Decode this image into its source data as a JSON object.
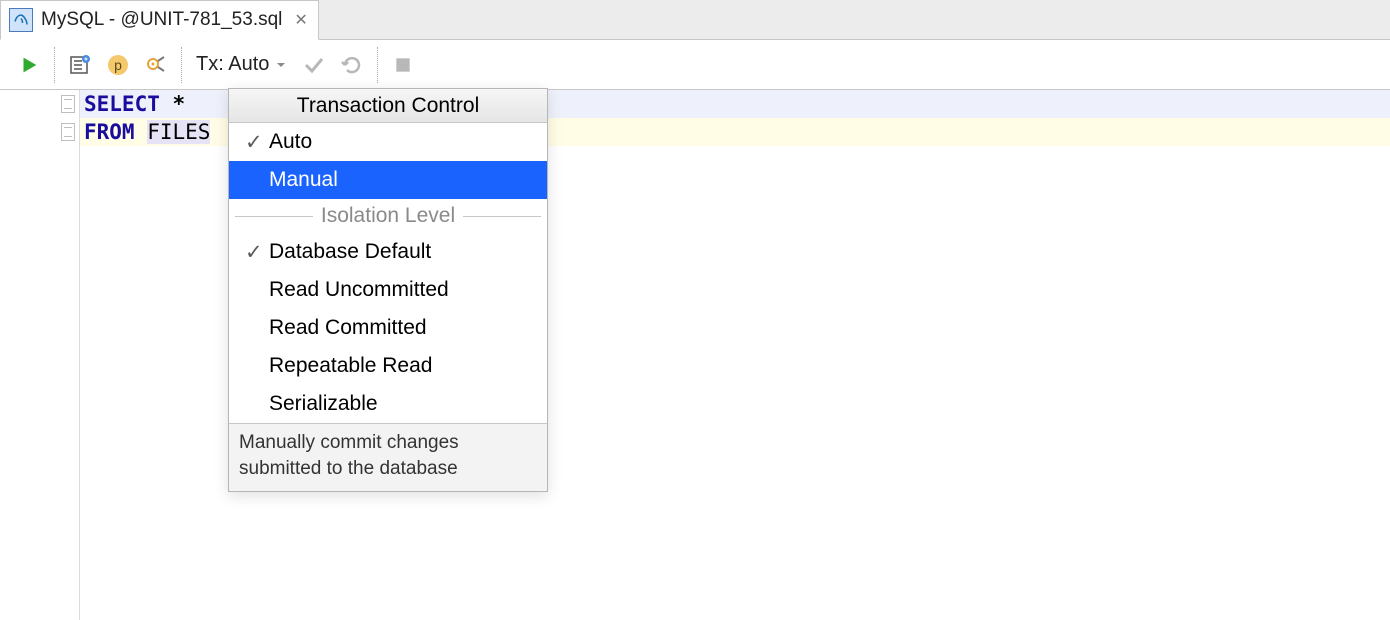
{
  "tab": {
    "title": "MySQL - @UNIT-781_53.sql"
  },
  "toolbar": {
    "tx_label": "Tx: Auto"
  },
  "code": {
    "line1_kw": "SELECT",
    "line1_rest": " *",
    "line2_kw": "FROM",
    "line2_tbl": "FILES"
  },
  "popup": {
    "header": "Transaction Control",
    "items_txctrl": [
      {
        "label": "Auto",
        "checked": true,
        "selected": false
      },
      {
        "label": "Manual",
        "checked": false,
        "selected": true
      }
    ],
    "sep_label": "Isolation Level",
    "items_iso": [
      {
        "label": "Database Default",
        "checked": true
      },
      {
        "label": "Read Uncommitted",
        "checked": false
      },
      {
        "label": "Read Committed",
        "checked": false
      },
      {
        "label": "Repeatable Read",
        "checked": false
      },
      {
        "label": "Serializable",
        "checked": false
      }
    ],
    "description": "Manually commit changes submitted to the database"
  }
}
